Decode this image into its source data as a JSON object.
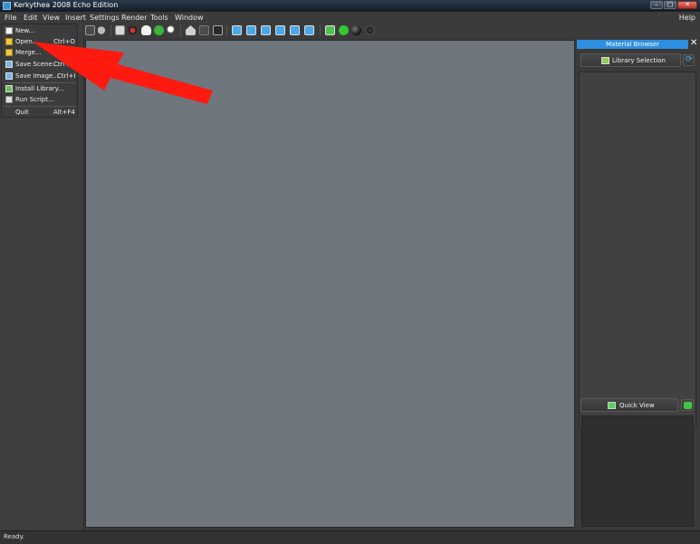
{
  "window": {
    "title": "Kerkythea 2008 Echo Edition",
    "minimize": "–",
    "maximize": "□",
    "close": "✕"
  },
  "menu": {
    "items": [
      "File",
      "Edit",
      "View",
      "Insert",
      "Settings",
      "Render",
      "Tools",
      "Window"
    ],
    "help": "Help"
  },
  "file_menu": {
    "items": [
      {
        "label": "New...",
        "shortcut": "",
        "icon": "new-file-icon"
      },
      {
        "label": "Open...",
        "shortcut": "Ctrl+O",
        "icon": "folder-open-icon"
      },
      {
        "label": "Merge...",
        "shortcut": "",
        "icon": "folder-merge-icon"
      },
      {
        "label": "Save Scene...",
        "shortcut": "Ctrl+S",
        "icon": "save-scene-icon"
      },
      {
        "label": "Save Image...",
        "shortcut": "Ctrl+I",
        "icon": "save-image-icon"
      },
      {
        "label": "Install Library...",
        "shortcut": "",
        "icon": "install-library-icon"
      },
      {
        "label": "Run Script...",
        "shortcut": "",
        "icon": "run-script-icon"
      },
      {
        "label": "Quit",
        "shortcut": "Alt+F4",
        "icon": ""
      }
    ]
  },
  "toolbar": {
    "icons": [
      "pencil-icon",
      "moon-icon",
      "select-icon",
      "render-icon",
      "hand-icon",
      "rotate-icon",
      "zoom-icon",
      "house-icon",
      "camera-icon",
      "light-icon",
      "box-front-icon",
      "box-back-icon",
      "box-left-icon",
      "box-right-icon",
      "box-top-icon",
      "box-bottom-icon",
      "export-icon",
      "add-icon",
      "sphere-icon",
      "torus-icon"
    ]
  },
  "material_browser": {
    "title": "Material Browser",
    "library_button": "Library Selection",
    "quick_view_button": "Quick View"
  },
  "status": {
    "text": "Ready."
  },
  "colors": {
    "accent": "#2e8fe0",
    "arrow": "#ff1a0f",
    "viewport": "#6f757d"
  }
}
